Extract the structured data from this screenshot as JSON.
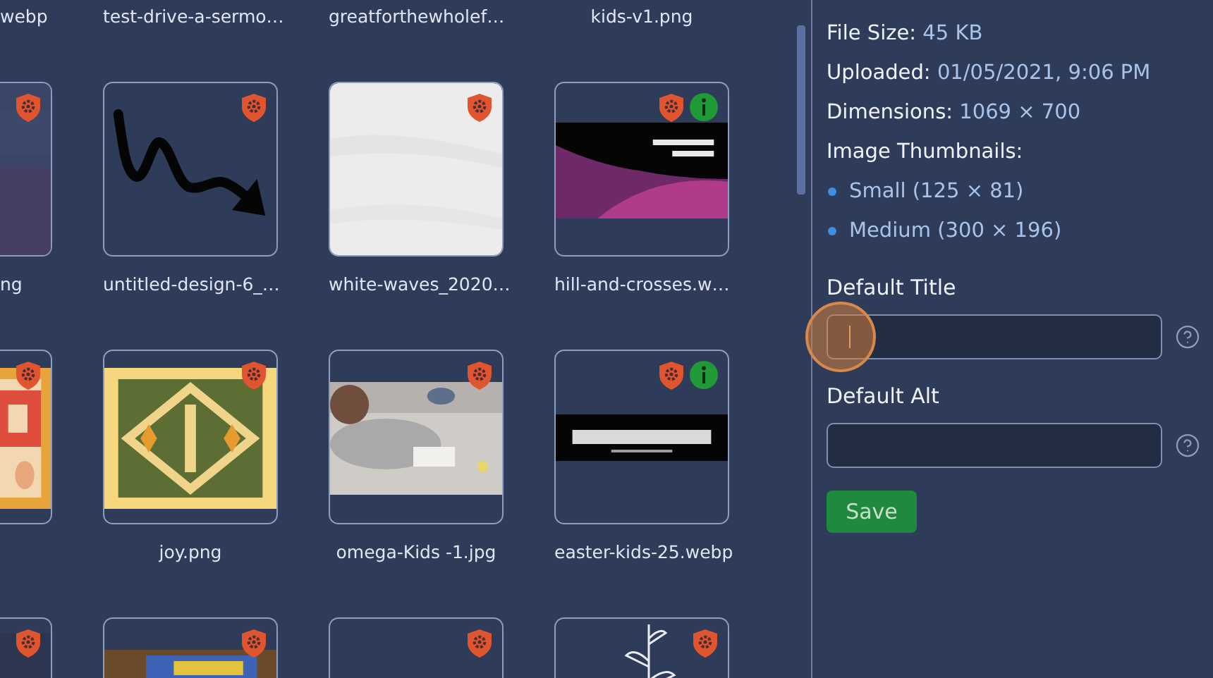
{
  "gallery": {
    "name_row": [
      "webp",
      "test-drive-a-sermo…",
      "greatforthewholef…",
      "kids-v1.png"
    ],
    "rows": [
      {
        "tiles": [
          {
            "name": "ng",
            "kind": "picture",
            "info": false
          },
          {
            "name": "untitled-design-6_…",
            "kind": "picture",
            "info": false
          },
          {
            "name": "white-waves_2020…",
            "kind": "picture",
            "info": false
          },
          {
            "name": "hill-and-crosses.w…",
            "kind": "picture",
            "info": true
          }
        ]
      },
      {
        "tiles": [
          {
            "kind": "picture",
            "info": false
          },
          {
            "name": "joy.png",
            "kind": "picture",
            "info": false
          },
          {
            "name": "omega-Kids -1.jpg",
            "kind": "picture",
            "info": false
          },
          {
            "name": "easter-kids-25.webp",
            "kind": "picture",
            "info": true
          }
        ]
      },
      {
        "tiles": [
          {
            "kind": "picture",
            "info": false
          },
          {
            "kind": "picture",
            "info": false
          },
          {
            "kind": "empty",
            "info": false
          },
          {
            "kind": "picture",
            "info": false
          }
        ]
      }
    ]
  },
  "details": {
    "facts": [
      {
        "label": "File Size:",
        "value": "45 KB"
      },
      {
        "label": "Uploaded:",
        "value": "01/05/2021, 9:06 PM"
      },
      {
        "label": "Dimensions:",
        "value": "1069 × 700"
      }
    ],
    "thumbnails_label": "Image Thumbnails:",
    "thumbnails": [
      "Small (125 × 81)",
      "Medium (300 × 196)"
    ],
    "fields": [
      {
        "label": "Default Title",
        "focused": true,
        "clicked": true
      },
      {
        "label": "Default Alt",
        "focused": false,
        "clicked": false
      }
    ],
    "save_button": "Save"
  }
}
